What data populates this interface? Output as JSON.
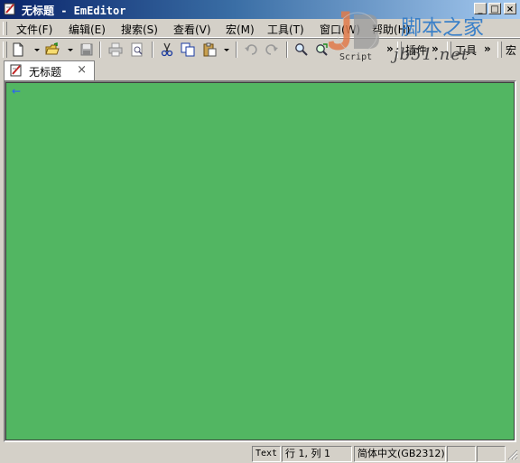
{
  "window": {
    "title": "无标题 - EmEditor"
  },
  "window_buttons": {
    "minimize": "_",
    "maximize": "□",
    "close": "×"
  },
  "watermark": {
    "chinese": "脚本之家",
    "domain": "jb51.net",
    "script_label": "Script",
    "logo_letters": "JB"
  },
  "menu": {
    "items": [
      {
        "label": "文件(F)"
      },
      {
        "label": "编辑(E)"
      },
      {
        "label": "搜索(S)"
      },
      {
        "label": "查看(V)"
      },
      {
        "label": "宏(M)"
      },
      {
        "label": "工具(T)"
      },
      {
        "label": "窗口(W)"
      },
      {
        "label": "帮助(H)"
      }
    ]
  },
  "toolbar": {
    "overflow": "»",
    "plugins_label": "插件",
    "tools_label": "工具",
    "macro_label": "宏"
  },
  "icons": {
    "new": "new-file-icon",
    "open": "open-folder-icon",
    "save": "save-icon",
    "print": "print-icon",
    "print_preview": "print-preview-icon",
    "cut": "cut-icon",
    "copy": "copy-icon",
    "paste": "paste-icon",
    "undo": "undo-icon",
    "redo": "redo-icon",
    "find": "find-icon",
    "find_next": "find-next-icon"
  },
  "tabs": [
    {
      "label": "无标题",
      "close": "×"
    }
  ],
  "editor": {
    "background": "#52b662",
    "line_marker": "←"
  },
  "status": {
    "mode": "Text",
    "position": "行 1, 列 1",
    "encoding": "简体中文(GB2312)",
    "panel4": "",
    "panel5": ""
  }
}
